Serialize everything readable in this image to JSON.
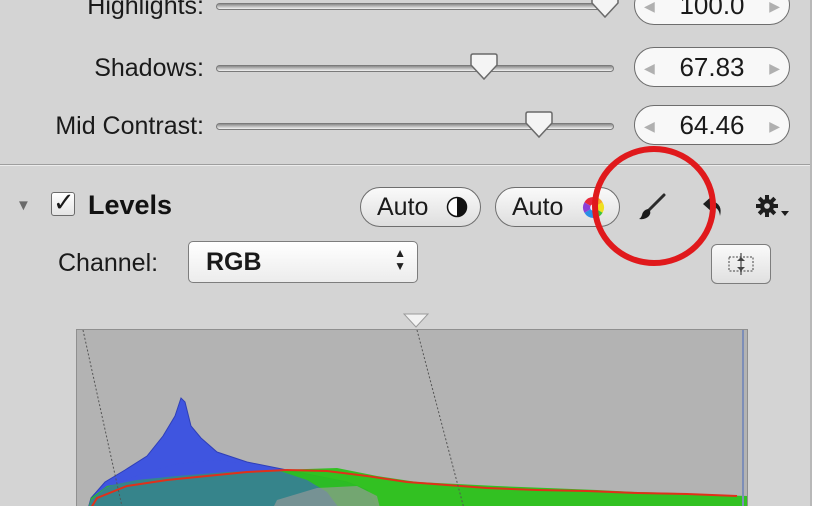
{
  "adjustments": {
    "highlights": {
      "label": "Highlights:",
      "value": "100.0",
      "slider_fraction": 0.94
    },
    "shadows": {
      "label": "Shadows:",
      "value": "67.83",
      "slider_fraction": 0.68
    },
    "mid_contrast": {
      "label": "Mid Contrast:",
      "value": "64.46",
      "slider_fraction": 0.81
    }
  },
  "levels": {
    "title": "Levels",
    "enabled": true,
    "disclosure_glyph": "▼",
    "checkmark_glyph": "✓",
    "auto_contrast_label": "Auto",
    "auto_color_label": "Auto",
    "channel_label": "Channel:",
    "channel_value": "RGB",
    "select_up_glyph": "▲",
    "select_down_glyph": "▼"
  },
  "stepper": {
    "left_glyph": "◀",
    "right_glyph": "▶"
  },
  "icons": {
    "brush": "brush-icon",
    "revert": "revert-arrow-icon",
    "gear": "gear-menu-icon",
    "fit": "fit-histogram-icon",
    "auto_contrast": "half-circle-contrast-icon",
    "auto_color": "color-wheel-icon"
  },
  "annotation": {
    "highlight_color": "#e0191c"
  },
  "colors": {
    "panel_bg": "#d4d4d4",
    "hist_blue": "#3f55e0",
    "hist_green": "#29c21a",
    "hist_red": "#e0301a"
  }
}
